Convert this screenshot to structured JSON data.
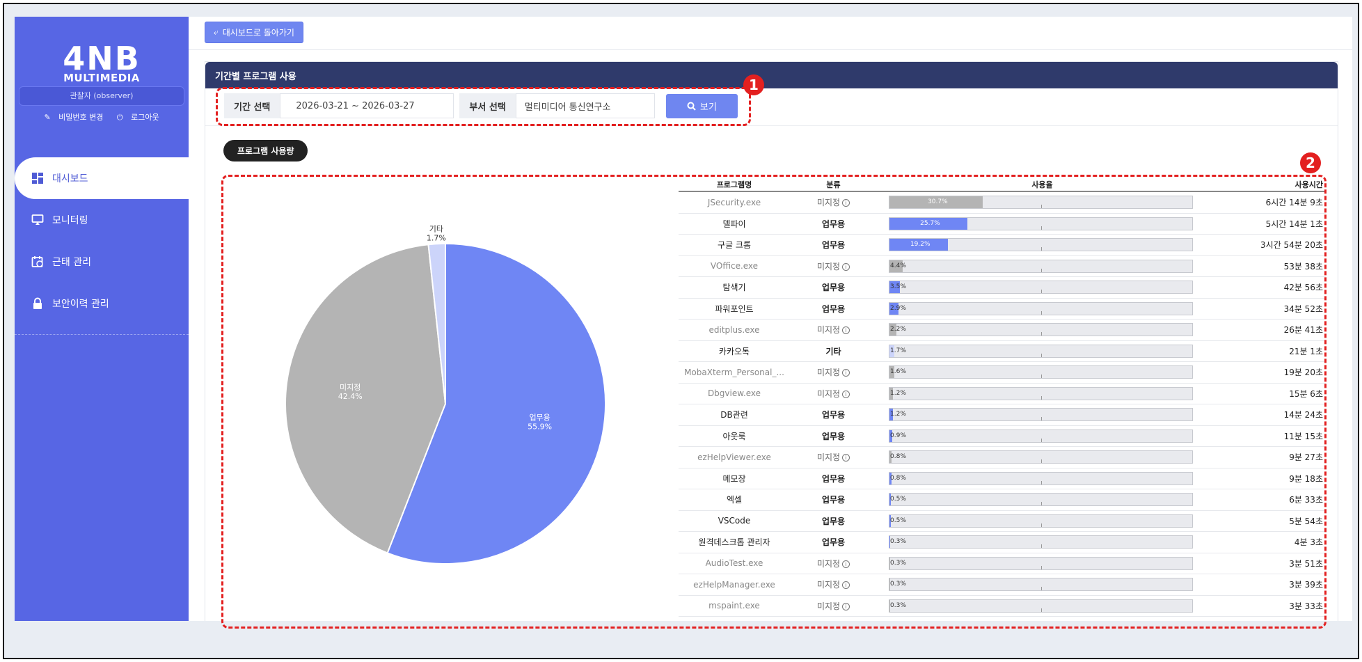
{
  "brand": {
    "logo_main": "4NB",
    "logo_sub": "MULTIMEDIA"
  },
  "user": {
    "role": "관찰자 (observer)",
    "change_password": "비밀번호 변경",
    "logout": "로그아웃"
  },
  "nav": {
    "dashboard": "대시보드",
    "monitoring": "모니터링",
    "attendance": "근태 관리",
    "security": "보안이력 관리"
  },
  "header": {
    "back_label": "대시보드로 돌아가기"
  },
  "panel": {
    "title": "기간별 프로그램 사용"
  },
  "filter": {
    "period_label": "기간 선택",
    "period_value": "2026-03-21 ~ 2026-03-27",
    "dept_label": "부서 선택",
    "dept_value": "멀티미디어 통신연구소",
    "search_label": "보기"
  },
  "markers": {
    "m1": "1",
    "m2": "2"
  },
  "usage_pill": "프로그램 사용량",
  "colors": {
    "work": "#6f86f4",
    "unknown": "#b4b4b4",
    "etc": "#ccd4fa",
    "sidebar": "#5766e4",
    "header": "#2f3a6b"
  },
  "chart_data": {
    "type": "pie",
    "slices": [
      {
        "label": "업무용",
        "value": 55.9,
        "display": "55.9%",
        "color": "#6f86f4"
      },
      {
        "label": "미지정",
        "value": 42.4,
        "display": "42.4%",
        "color": "#b4b4b4"
      },
      {
        "label": "기타",
        "value": 1.7,
        "display": "1.7%",
        "color": "#ccd4fa"
      }
    ]
  },
  "table": {
    "headers": {
      "name": "프로그램명",
      "category": "분류",
      "usage": "사용율",
      "time": "사용시간"
    },
    "rows": [
      {
        "name": "JSecurity.exe",
        "cat": "미지정",
        "type": "unknown",
        "pct": 30.7,
        "label": "30.7%",
        "time": "6시간 14분 9초"
      },
      {
        "name": "델파이",
        "cat": "업무용",
        "type": "work",
        "pct": 25.7,
        "label": "25.7%",
        "time": "5시간 14분 1초"
      },
      {
        "name": "구글 크롬",
        "cat": "업무용",
        "type": "work",
        "pct": 19.2,
        "label": "19.2%",
        "time": "3시간 54분 20초"
      },
      {
        "name": "VOffice.exe",
        "cat": "미지정",
        "type": "unknown",
        "pct": 4.4,
        "label": "4.4%",
        "time": "53분 38초"
      },
      {
        "name": "탐색기",
        "cat": "업무용",
        "type": "work",
        "pct": 3.5,
        "label": "3.5%",
        "time": "42분 56초"
      },
      {
        "name": "파워포인트",
        "cat": "업무용",
        "type": "work",
        "pct": 2.9,
        "label": "2.9%",
        "time": "34분 52초"
      },
      {
        "name": "editplus.exe",
        "cat": "미지정",
        "type": "unknown",
        "pct": 2.2,
        "label": "2.2%",
        "time": "26분 41초"
      },
      {
        "name": "카카오톡",
        "cat": "기타",
        "type": "etc",
        "pct": 1.7,
        "label": "1.7%",
        "time": "21분 1초"
      },
      {
        "name": "MobaXterm_Personal_...",
        "cat": "미지정",
        "type": "unknown",
        "pct": 1.6,
        "label": "1.6%",
        "time": "19분 20초"
      },
      {
        "name": "Dbgview.exe",
        "cat": "미지정",
        "type": "unknown",
        "pct": 1.2,
        "label": "1.2%",
        "time": "15분 6초"
      },
      {
        "name": "DB관련",
        "cat": "업무용",
        "type": "work",
        "pct": 1.2,
        "label": "1.2%",
        "time": "14분 24초"
      },
      {
        "name": "아웃룩",
        "cat": "업무용",
        "type": "work",
        "pct": 0.9,
        "label": "0.9%",
        "time": "11분 15초"
      },
      {
        "name": "ezHelpViewer.exe",
        "cat": "미지정",
        "type": "unknown",
        "pct": 0.8,
        "label": "0.8%",
        "time": "9분 27초"
      },
      {
        "name": "메모장",
        "cat": "업무용",
        "type": "work",
        "pct": 0.8,
        "label": "0.8%",
        "time": "9분 18초"
      },
      {
        "name": "엑셀",
        "cat": "업무용",
        "type": "work",
        "pct": 0.5,
        "label": "0.5%",
        "time": "6분 33초"
      },
      {
        "name": "VSCode",
        "cat": "업무용",
        "type": "work",
        "pct": 0.5,
        "label": "0.5%",
        "time": "5분 54초"
      },
      {
        "name": "원격데스크톱 관리자",
        "cat": "업무용",
        "type": "work",
        "pct": 0.3,
        "label": "0.3%",
        "time": "4분 3초"
      },
      {
        "name": "AudioTest.exe",
        "cat": "미지정",
        "type": "unknown",
        "pct": 0.3,
        "label": "0.3%",
        "time": "3분 51초"
      },
      {
        "name": "ezHelpManager.exe",
        "cat": "미지정",
        "type": "unknown",
        "pct": 0.3,
        "label": "0.3%",
        "time": "3분 39초"
      },
      {
        "name": "mspaint.exe",
        "cat": "미지정",
        "type": "unknown",
        "pct": 0.3,
        "label": "0.3%",
        "time": "3분 33초"
      }
    ]
  }
}
